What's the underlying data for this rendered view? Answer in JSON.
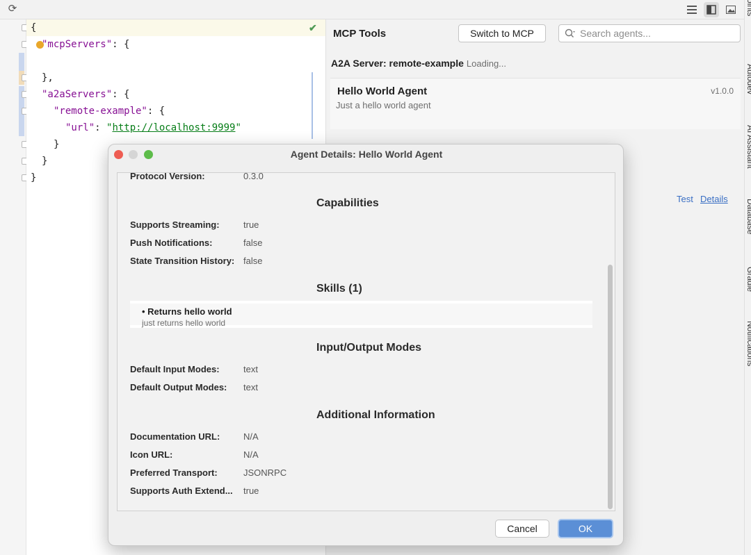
{
  "editor": {
    "lines": {
      "l1": "{",
      "mcp_key": "\"mcpServers\"",
      "mcp_rest": ": {",
      "l4": "},",
      "a2a_key": "\"a2aServers\"",
      "a2a_rest": ": {",
      "remote_key": "\"remote-example\"",
      "remote_rest": ": {",
      "url_key": "\"url\"",
      "url_sep": ": ",
      "url_q1": "\"",
      "url_val": "http://localhost:9999",
      "url_q2": "\"",
      "l8": "}",
      "l9": "}",
      "l10": "}"
    }
  },
  "panel": {
    "title": "MCP Tools",
    "switch_label": "Switch to MCP",
    "search_placeholder": "Search agents...",
    "server_label": "A2A Server: remote-example",
    "server_status": "Loading...",
    "agent": {
      "name": "Hello World Agent",
      "version": "v1.0.0",
      "description": "Just a hello world agent"
    },
    "test_link": "Test",
    "details_link": "Details"
  },
  "side_strip": {
    "items": [
      "Endpoints",
      "Autodev",
      "AI Assistant",
      "Database",
      "Gradle",
      "Notifications"
    ]
  },
  "dialog": {
    "title": "Agent Details: Hello World Agent",
    "protocol": {
      "label": "Protocol Version:",
      "value": "0.3.0"
    },
    "capabilities": {
      "title": "Capabilities",
      "streaming": {
        "label": "Supports Streaming:",
        "value": "true"
      },
      "push": {
        "label": "Push Notifications:",
        "value": "false"
      },
      "history": {
        "label": "State Transition History:",
        "value": "false"
      }
    },
    "skills": {
      "title": "Skills (1)",
      "items": [
        {
          "name": "• Returns hello world",
          "description": "just returns hello world"
        }
      ]
    },
    "io_modes": {
      "title": "Input/Output Modes",
      "input": {
        "label": "Default Input Modes:",
        "value": "text"
      },
      "output": {
        "label": "Default Output Modes:",
        "value": "text"
      }
    },
    "additional": {
      "title": "Additional Information",
      "doc_url": {
        "label": "Documentation URL:",
        "value": "N/A"
      },
      "icon_url": {
        "label": "Icon URL:",
        "value": "N/A"
      },
      "transport": {
        "label": "Preferred Transport:",
        "value": "JSONRPC"
      },
      "auth": {
        "label": "Supports Auth Extend...",
        "value": "true"
      }
    },
    "cancel_label": "Cancel",
    "ok_label": "OK"
  },
  "colors": {
    "accent": "#5b8fd6",
    "link": "#3a6fc4",
    "json_key": "#871094",
    "json_string": "#067d17"
  }
}
